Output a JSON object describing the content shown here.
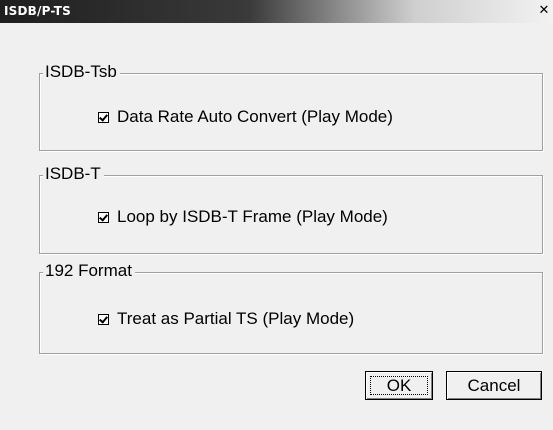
{
  "window": {
    "title": "ISDB/P-TS",
    "close_glyph": "✕"
  },
  "groups": [
    {
      "label": "ISDB-Tsb",
      "option": {
        "label": "Data Rate Auto Convert (Play Mode)",
        "checked": true
      }
    },
    {
      "label": "ISDB-T",
      "option": {
        "label": "Loop by ISDB-T Frame (Play Mode)",
        "checked": true
      }
    },
    {
      "label": "192 Format",
      "option": {
        "label": "Treat as Partial TS (Play Mode)",
        "checked": true
      }
    }
  ],
  "buttons": {
    "ok": "OK",
    "cancel": "Cancel"
  }
}
